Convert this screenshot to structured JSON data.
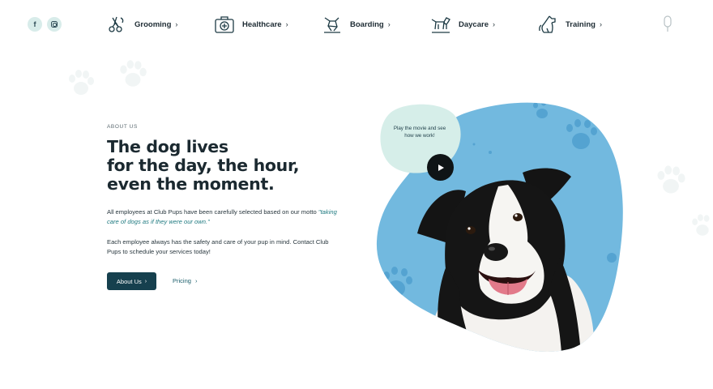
{
  "social": [
    {
      "name": "facebook",
      "glyph": "f"
    },
    {
      "name": "instagram",
      "glyph": ""
    }
  ],
  "nav": {
    "items": [
      {
        "label": "Grooming",
        "icon": "scissors-icon"
      },
      {
        "label": "Healthcare",
        "icon": "medical-kit-icon"
      },
      {
        "label": "Boarding",
        "icon": "dog-house-icon"
      },
      {
        "label": "Daycare",
        "icon": "dog-play-icon"
      },
      {
        "label": "Training",
        "icon": "sitting-dog-icon"
      }
    ],
    "chevron": "›",
    "mic_icon": "microphone-icon"
  },
  "hero": {
    "eyebrow": "ABOUT US",
    "headline_lines": [
      "The dog lives",
      "for the day, the hour,",
      "even the moment."
    ],
    "para1_prefix": "All employees at Club Pups have been carefully selected based on our motto ",
    "para1_motto": "\"taking care of dogs as if they were our own.\"",
    "para2": "Each employee always has the safety and care of your pup in mind. Contact Club Pups to schedule your services today!",
    "primary_button": "About Us",
    "secondary_link": "Pricing",
    "chevron": "›"
  },
  "media": {
    "play_text": "Play the movie and see how we work!",
    "play_icon": "play-icon"
  },
  "colors": {
    "accent_dark": "#16404e",
    "blob_blue": "#72b9df",
    "bubble_mint": "#d6eee9",
    "paw_bg": "#e9f0f0"
  }
}
